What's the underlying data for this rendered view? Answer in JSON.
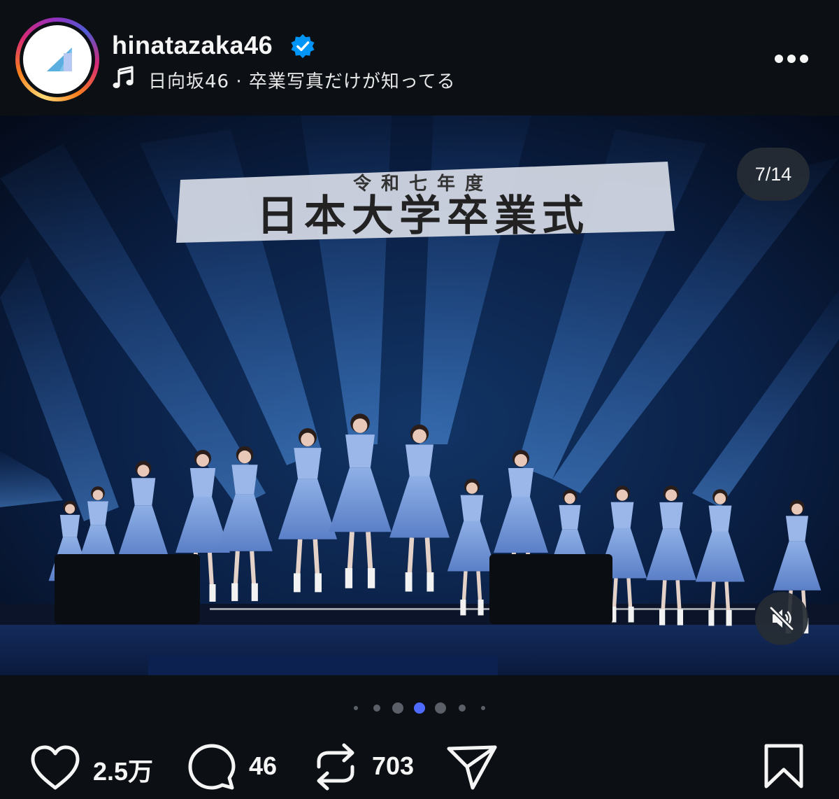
{
  "header": {
    "username": "hinatazaka46",
    "song": "日向坂46 · 卒業写真だけが知ってる",
    "verified": true
  },
  "post": {
    "counter": "7/14",
    "banner_small": "令和七年度",
    "banner_large": "日本大学卒業式"
  },
  "carousel": {
    "active_index": 3,
    "dot_count": 7
  },
  "actions": {
    "likes": "2.5万",
    "comments": "46",
    "reposts": "703"
  },
  "colors": {
    "background": "#0c1014",
    "verified_blue": "#0095f6",
    "active_dot": "#4f6bff"
  },
  "icons": {
    "like": "heart-icon",
    "comment": "comment-bubble-icon",
    "repost": "repost-icon",
    "share": "send-icon",
    "save": "bookmark-icon",
    "mute": "speaker-muted-icon",
    "more": "more-options-icon"
  }
}
